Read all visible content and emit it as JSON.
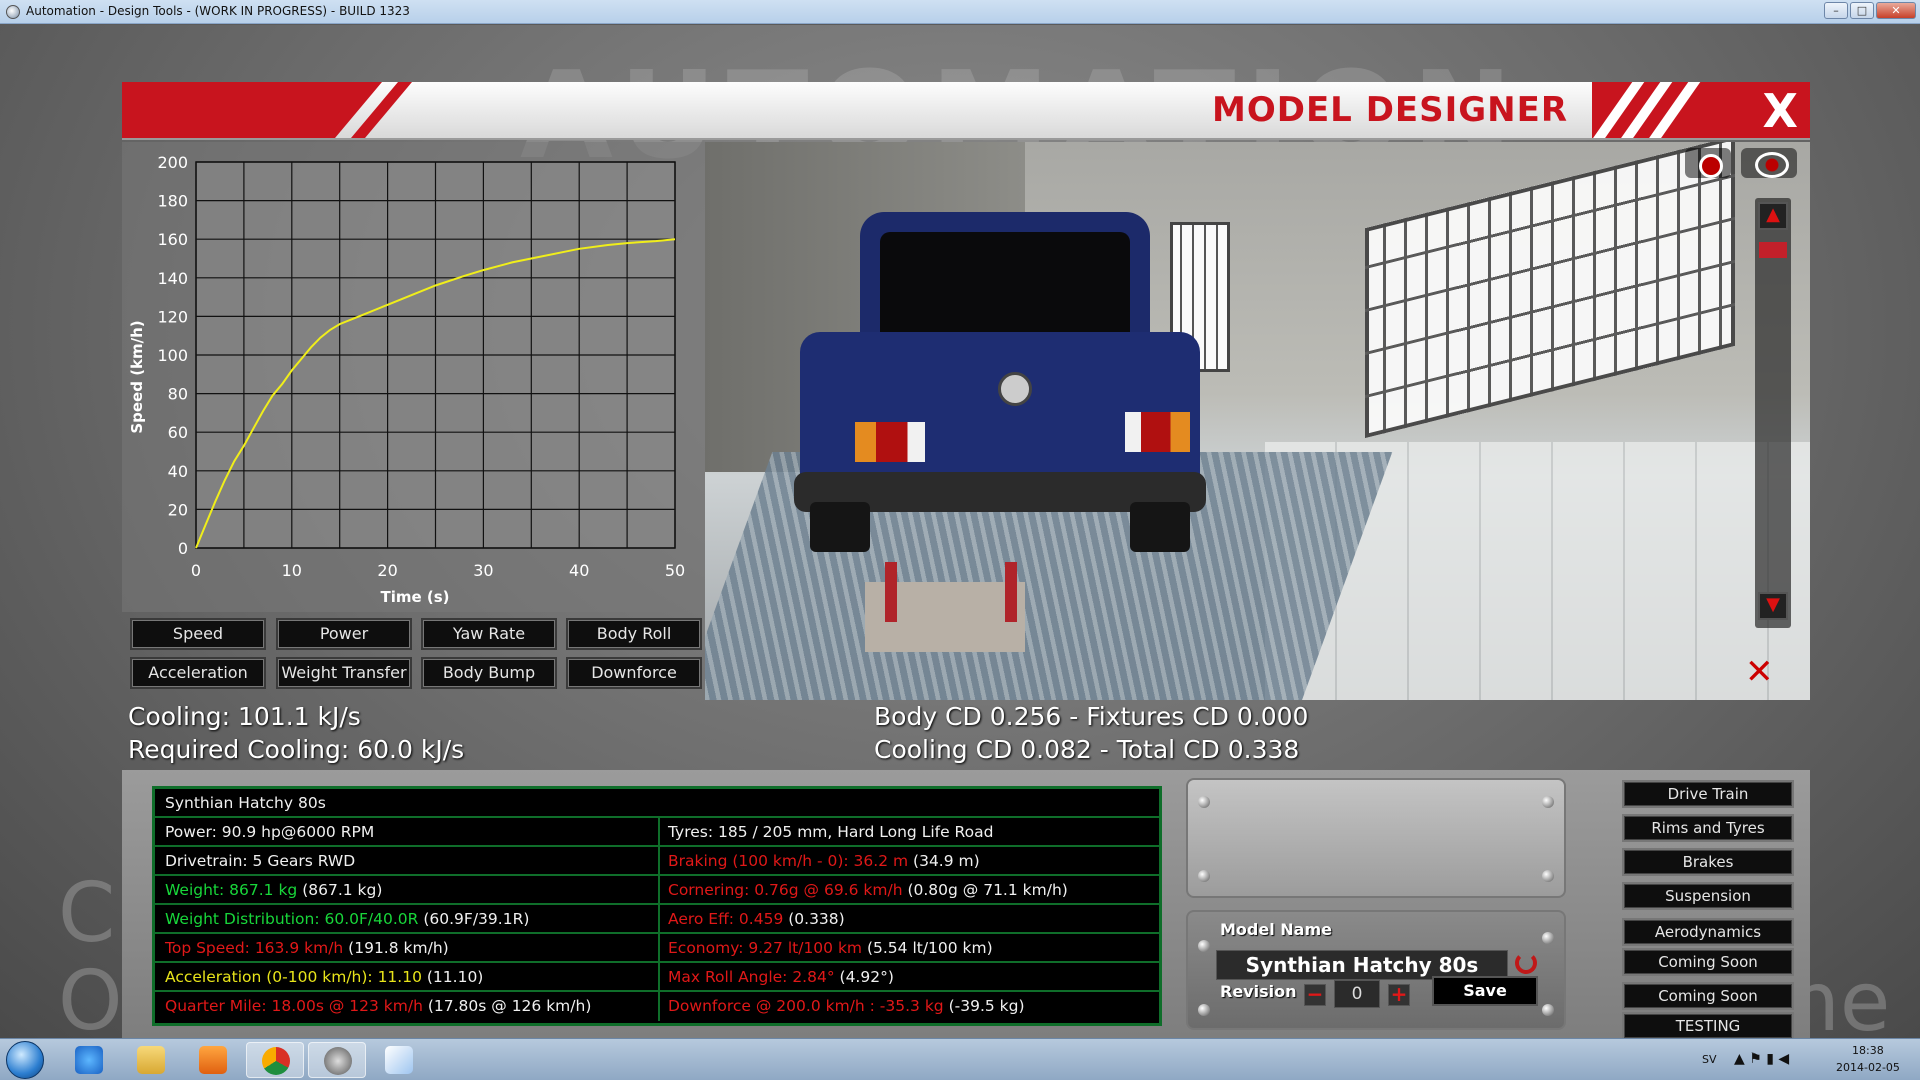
{
  "window": {
    "title": "Automation - Design Tools - (WORK IN PROGRESS) - BUILD 1323",
    "minimize": "–",
    "maximize": "□",
    "close": "✕"
  },
  "background": {
    "brand": "AUTOMATION",
    "left_fragment_1": "C",
    "left_fragment_2": "O",
    "right_fragment": "me"
  },
  "header": {
    "title": "MODEL DESIGNER",
    "close_label": "X"
  },
  "chart_data": {
    "type": "line",
    "title": "",
    "xlabel": "Time (s)",
    "ylabel": "Speed (km/h)",
    "xlim": [
      0,
      50
    ],
    "ylim": [
      0,
      200
    ],
    "xticks": [
      0,
      10,
      20,
      30,
      40,
      50
    ],
    "yticks": [
      0,
      20,
      40,
      60,
      80,
      100,
      120,
      140,
      160,
      180,
      200
    ],
    "grid": true,
    "line_color": "#f0ee1a",
    "series": [
      {
        "x": [
          0,
          1,
          2,
          3,
          4,
          5,
          6,
          7,
          8,
          9,
          10,
          11,
          12,
          13,
          14,
          15,
          17,
          20,
          23,
          25,
          28,
          30,
          33,
          35,
          38,
          40,
          43,
          45,
          48,
          50
        ],
        "values": [
          0,
          12,
          24,
          35,
          45,
          53,
          62,
          71,
          79,
          85,
          92,
          98,
          104,
          109,
          113,
          116,
          120,
          126,
          132,
          136,
          141,
          144,
          148,
          150,
          153,
          155,
          157,
          158,
          159,
          160
        ]
      }
    ]
  },
  "chart_buttons": {
    "speed": "Speed",
    "power": "Power",
    "yaw_rate": "Yaw Rate",
    "body_roll": "Body Roll",
    "acceleration": "Acceleration",
    "weight_transfer": "Weight Transfer",
    "body_bump": "Body Bump",
    "downforce": "Downforce"
  },
  "cooling": {
    "cooling": "Cooling: 101.1 kJ/s",
    "required": "Required Cooling: 60.0 kJ/s"
  },
  "drag": {
    "line1": "Body CD 0.256 - Fixtures CD 0.000",
    "line2": "Cooling CD 0.082 - Total CD 0.338"
  },
  "info": {
    "name": "Synthian Hatchy 80s",
    "power": "Power: 90.9 hp@6000 RPM",
    "drivetrain": "Drivetrain: 5 Gears RWD",
    "weight_main": "Weight: 867.1 kg",
    "weight_alt": " (867.1 kg)",
    "weightdist_main": "Weight Distribution: 60.0F/40.0R",
    "weightdist_alt": " (60.9F/39.1R)",
    "topspeed_main": "Top Speed: 163.9 km/h",
    "topspeed_alt": " (191.8 km/h)",
    "accel_main": "Acceleration (0-100 km/h): 11.10",
    "accel_alt": " (11.10)",
    "quarter_main": "Quarter Mile: 18.00s @ 123 km/h",
    "quarter_alt": " (17.80s @ 126 km/h)",
    "tyres": "Tyres: 185 / 205 mm, Hard Long Life Road",
    "braking_main": "Braking (100 km/h - 0): 36.2 m",
    "braking_alt": " (34.9 m)",
    "cornering_main": "Cornering: 0.76g @ 69.6 km/h",
    "cornering_alt": " (0.80g @ 71.1 km/h)",
    "aero_main": "Aero Eff: 0.459",
    "aero_alt": " (0.338)",
    "economy_main": "Economy: 9.27 lt/100 km",
    "economy_alt": " (5.54 lt/100 km)",
    "roll_main": "Max Roll Angle: 2.84°",
    "roll_alt": " (4.92°)",
    "downforce_main": "Downforce @ 200.0 km/h : -35.3 kg",
    "downforce_alt": " (-39.5 kg)"
  },
  "model": {
    "name_label": "Model Name",
    "name_value": "Synthian Hatchy 80s",
    "revision_label": "Revision",
    "revision_value": "0",
    "minus": "−",
    "plus": "+",
    "save": "Save"
  },
  "nav": {
    "drive_train": "Drive Train",
    "rims_tyres": "Rims and Tyres",
    "brakes": "Brakes",
    "suspension": "Suspension",
    "aerodynamics": "Aerodynamics",
    "coming_soon_1": "Coming Soon",
    "coming_soon_2": "Coming Soon",
    "testing": "TESTING"
  },
  "taskbar": {
    "lang": "SV",
    "time": "18:38",
    "date": "2014-02-05",
    "icons": [
      "ie-icon",
      "folder-icon",
      "media-player-icon",
      "chrome-icon",
      "automation-app-icon",
      "paint-icon"
    ]
  }
}
